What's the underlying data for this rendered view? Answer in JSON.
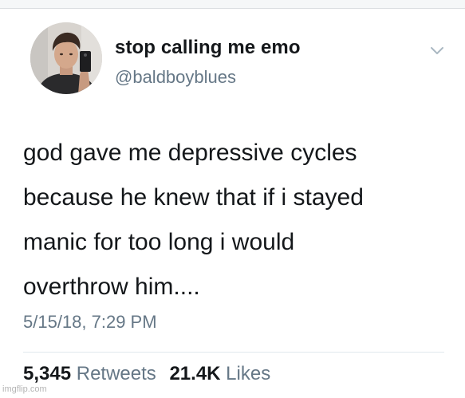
{
  "tweet": {
    "display_name": "stop calling me emo",
    "handle": "@baldboyblues",
    "text_lines": [
      "god gave me depressive cycles",
      "because he knew that if i stayed",
      "manic for too long i would",
      "overthrow him...."
    ],
    "timestamp": "5/15/18, 7:29 PM",
    "retweets_count": "5,345",
    "retweets_label": "Retweets",
    "likes_count": "21.4K",
    "likes_label": "Likes",
    "menu_icon": "chevron-down-icon",
    "avatar": "avatar"
  },
  "watermark": "imgflip.com",
  "colors": {
    "primary_text": "#14171a",
    "secondary_text": "#657786",
    "divider": "#e1e8ed"
  }
}
